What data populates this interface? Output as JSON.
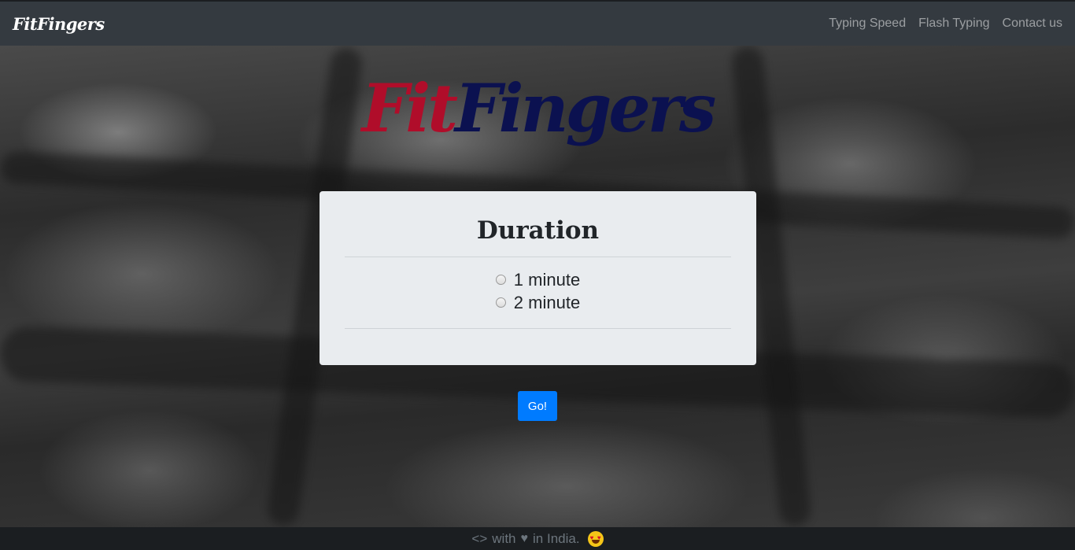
{
  "navbar": {
    "brand": "FitFingers",
    "links": [
      "Typing Speed",
      "Flash Typing",
      "Contact us"
    ]
  },
  "hero": {
    "logo_part1": "Fit",
    "logo_part2": "Fingers"
  },
  "duration_card": {
    "title": "Duration",
    "options": [
      "1 minute",
      "2 minute"
    ],
    "selected": null
  },
  "go_button": {
    "label": "Go!"
  },
  "footer": {
    "code_symbol": "<>",
    "with_text": "with",
    "location_text": "in India."
  },
  "colors": {
    "logo_red": "#b00d2a",
    "logo_navy": "#0b1150",
    "primary": "#007bff",
    "navbar": "#343a40"
  },
  "icons": {
    "heart": "heart-icon",
    "emoji": "heart-eyes-emoji-icon"
  }
}
